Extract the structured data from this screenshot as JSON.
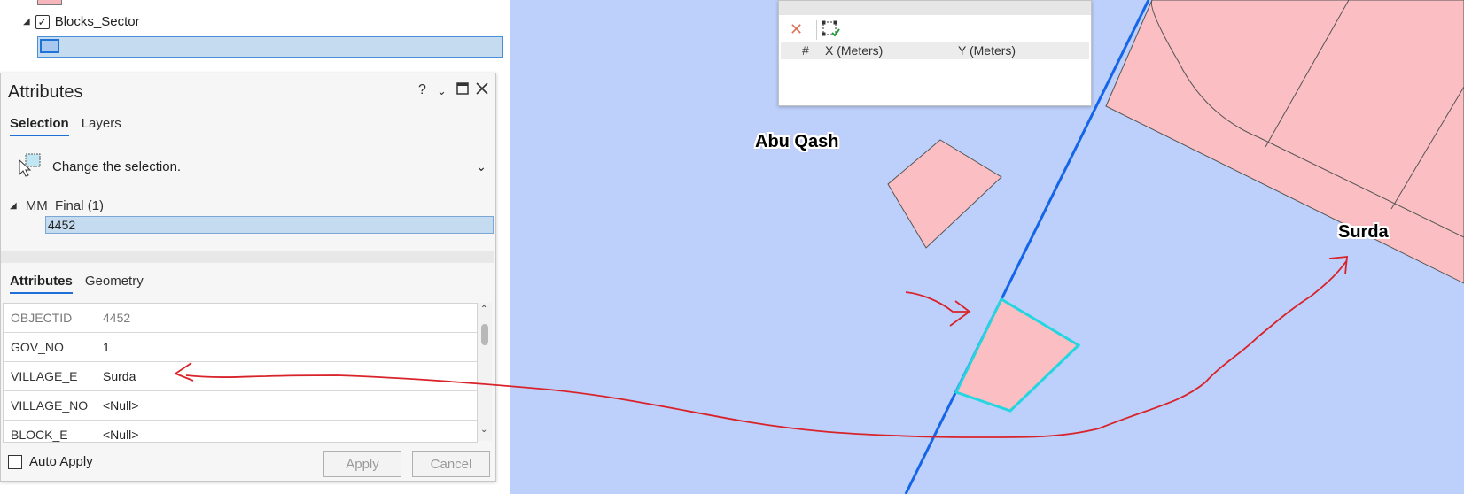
{
  "toc": {
    "layer_name": "Blocks_Sector"
  },
  "attributes_pane": {
    "title": "Attributes",
    "help_label": "?",
    "top_tabs": [
      "Selection",
      "Layers"
    ],
    "change_selection_label": "Change the selection.",
    "tree_layer": "MM_Final (1)",
    "tree_item": "4452",
    "bottom_tabs": [
      "Attributes",
      "Geometry"
    ],
    "rows": [
      {
        "name": "OBJECTID",
        "value": "4452"
      },
      {
        "name": "GOV_NO",
        "value": "1"
      },
      {
        "name": "VILLAGE_E",
        "value": "Surda"
      },
      {
        "name": "VILLAGE_NO",
        "value": "<Null>"
      },
      {
        "name": "BLOCK_E",
        "value": "<Null>"
      }
    ],
    "auto_apply_label": "Auto Apply",
    "apply_label": "Apply",
    "cancel_label": "Cancel"
  },
  "coordinate_window": {
    "col_index": "#",
    "col_x": "X (Meters)",
    "col_y": "Y (Meters)"
  },
  "map": {
    "labels": [
      "Abu Qash",
      "Surda"
    ],
    "colors": {
      "background": "#bdd0fb",
      "parcel_fill": "#fbbec2",
      "selected_outline": "#25d6e0",
      "boundary_line": "#1565e8",
      "annotation": "#d9232b"
    }
  }
}
